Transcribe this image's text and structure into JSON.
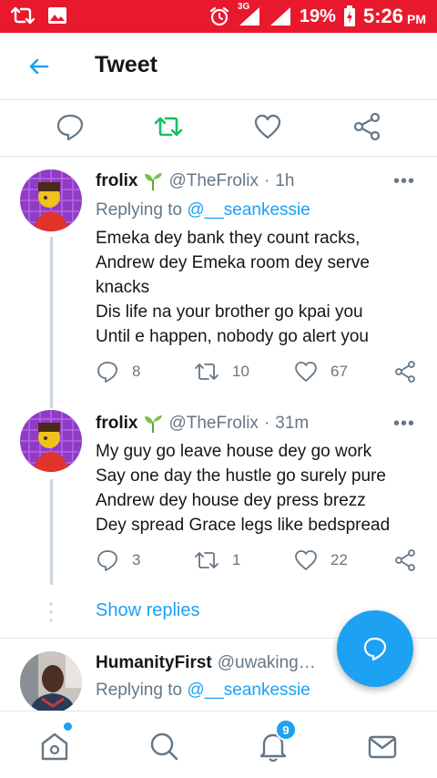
{
  "statusbar": {
    "network": "3G",
    "battery": "19%",
    "time": "5:26",
    "ampm": "PM"
  },
  "header": {
    "title": "Tweet"
  },
  "tweets": [
    {
      "name": "frolix",
      "handle": "@TheFrolix",
      "dot": "·",
      "time": "1h",
      "reply_prefix": "Replying to",
      "reply_mention": "@__seankessie",
      "lines": [
        "Emeka dey bank they count racks,",
        "Andrew dey Emeka room dey serve",
        "knacks",
        "Dis life na your brother go kpai you",
        "Until e happen, nobody go alert you"
      ],
      "replies": "8",
      "retweets": "10",
      "likes": "67"
    },
    {
      "name": "frolix",
      "handle": "@TheFrolix",
      "dot": "·",
      "time": "31m",
      "lines": [
        "My guy go leave house dey go work",
        "Say one day the hustle go surely pure",
        "Andrew dey house dey press brezz",
        "Dey spread Grace legs like bedspread"
      ],
      "replies": "3",
      "retweets": "1",
      "likes": "22"
    },
    {
      "name": "HumanityFirst",
      "handle": "@uwaking…",
      "reply_prefix": "Replying to",
      "reply_mention": "@__seankessie"
    }
  ],
  "show_replies": "Show replies",
  "more_glyph": "•••",
  "bottom_nav": {
    "notifications_count": "9"
  },
  "colors": {
    "statusbar": "#e8192c",
    "accent": "#1da1f2",
    "retweet": "#17bf63",
    "muted": "#657786"
  }
}
